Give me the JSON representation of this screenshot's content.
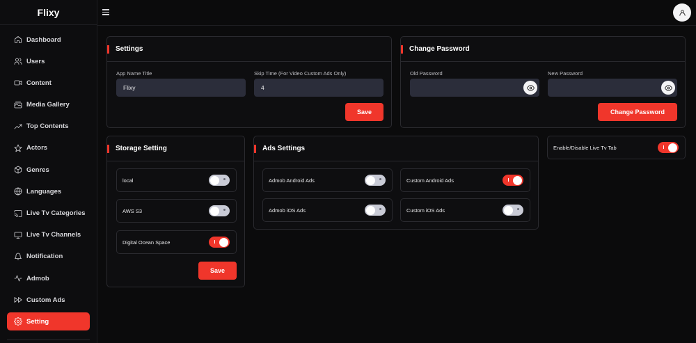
{
  "app": {
    "brand": "Flixy"
  },
  "sidebar": {
    "items": [
      {
        "label": "Dashboard",
        "icon": "home-icon"
      },
      {
        "label": "Users",
        "icon": "users-icon"
      },
      {
        "label": "Content",
        "icon": "video-icon"
      },
      {
        "label": "Media Gallery",
        "icon": "gallery-icon"
      },
      {
        "label": "Top Contents",
        "icon": "trending-icon"
      },
      {
        "label": "Actors",
        "icon": "star-icon"
      },
      {
        "label": "Genres",
        "icon": "box-icon"
      },
      {
        "label": "Languages",
        "icon": "globe-icon"
      },
      {
        "label": "Live Tv Categories",
        "icon": "cast-icon"
      },
      {
        "label": "Live Tv Channels",
        "icon": "tv-icon"
      },
      {
        "label": "Notification",
        "icon": "bell-icon"
      },
      {
        "label": "Admob",
        "icon": "activity-icon"
      },
      {
        "label": "Custom Ads",
        "icon": "fast-forward-icon"
      },
      {
        "label": "Setting",
        "icon": "gear-icon",
        "active": true
      }
    ]
  },
  "settings": {
    "title": "Settings",
    "app_name_label": "App Name Title",
    "app_name_value": "Flixy",
    "skip_time_label": "Skip Time (For Video Custom Ads Only)",
    "skip_time_value": "4",
    "save_label": "Save"
  },
  "change_password": {
    "title": "Change Password",
    "old_label": "Old Password",
    "new_label": "New Password",
    "button_label": "Change Password"
  },
  "storage": {
    "title": "Storage Setting",
    "options": [
      {
        "label": "local",
        "on": false
      },
      {
        "label": "AWS S3",
        "on": false
      },
      {
        "label": "Digital Ocean Space",
        "on": true
      }
    ],
    "save_label": "Save"
  },
  "ads": {
    "title": "Ads Settings",
    "options": [
      {
        "label": "Admob Android Ads",
        "on": false
      },
      {
        "label": "Custom Android Ads",
        "on": true
      },
      {
        "label": "Admob iOS Ads",
        "on": false
      },
      {
        "label": "Custom iOS Ads",
        "on": false
      }
    ]
  },
  "live_tv": {
    "label": "Enable/Disable Live Tv Tab",
    "on": true
  },
  "colors": {
    "accent": "#f0362b",
    "input_bg": "#2b2d3a",
    "card_border": "#2a2a2f"
  }
}
